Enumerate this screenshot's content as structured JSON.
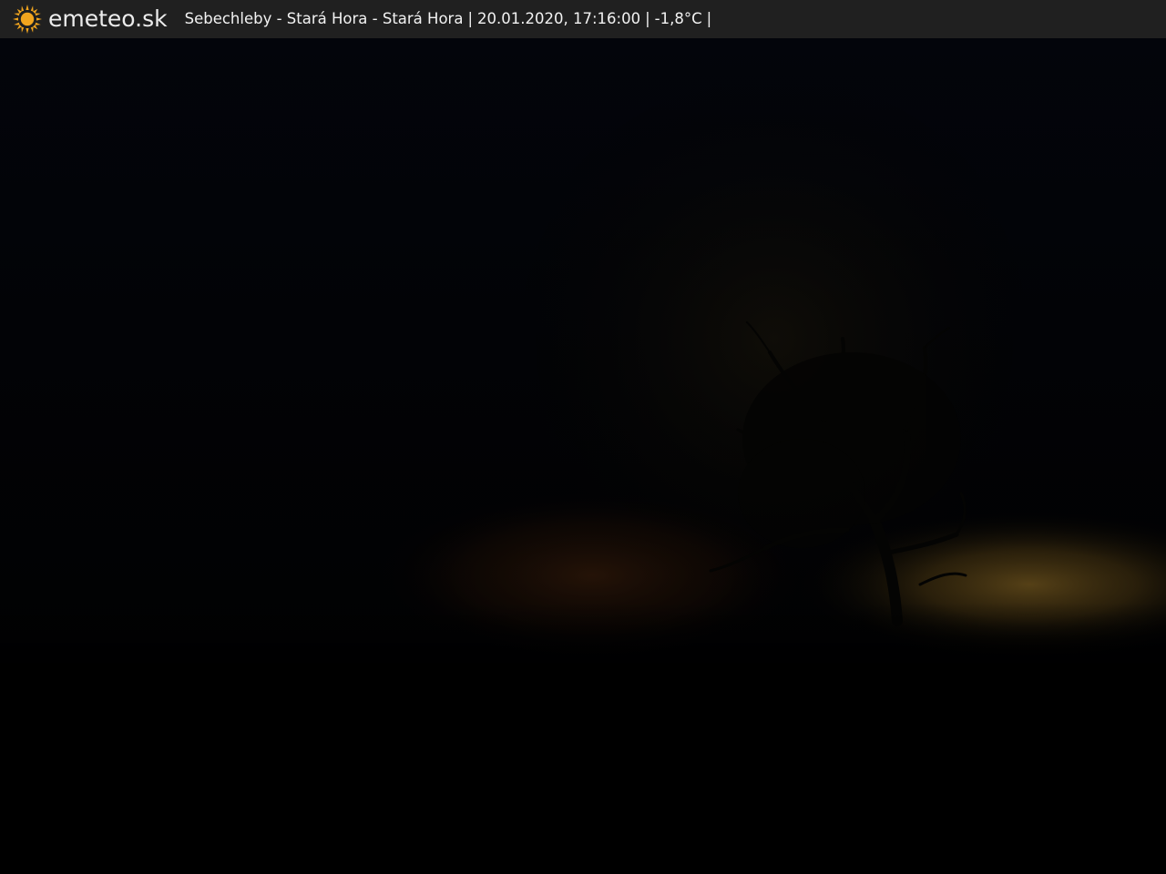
{
  "header": {
    "logo_text": "emeteo.sk",
    "logo_icon": "sun-icon",
    "location": "Sebechleby - Stará Hora - Stará Hora",
    "datetime": "20.01.2020, 17:16:00",
    "temperature": "-1,8°C",
    "separator": "|"
  },
  "colors": {
    "bar_background": "#202020",
    "sun": "#f2a51e",
    "text": "#f2f2f2",
    "image_background": "#000000"
  }
}
